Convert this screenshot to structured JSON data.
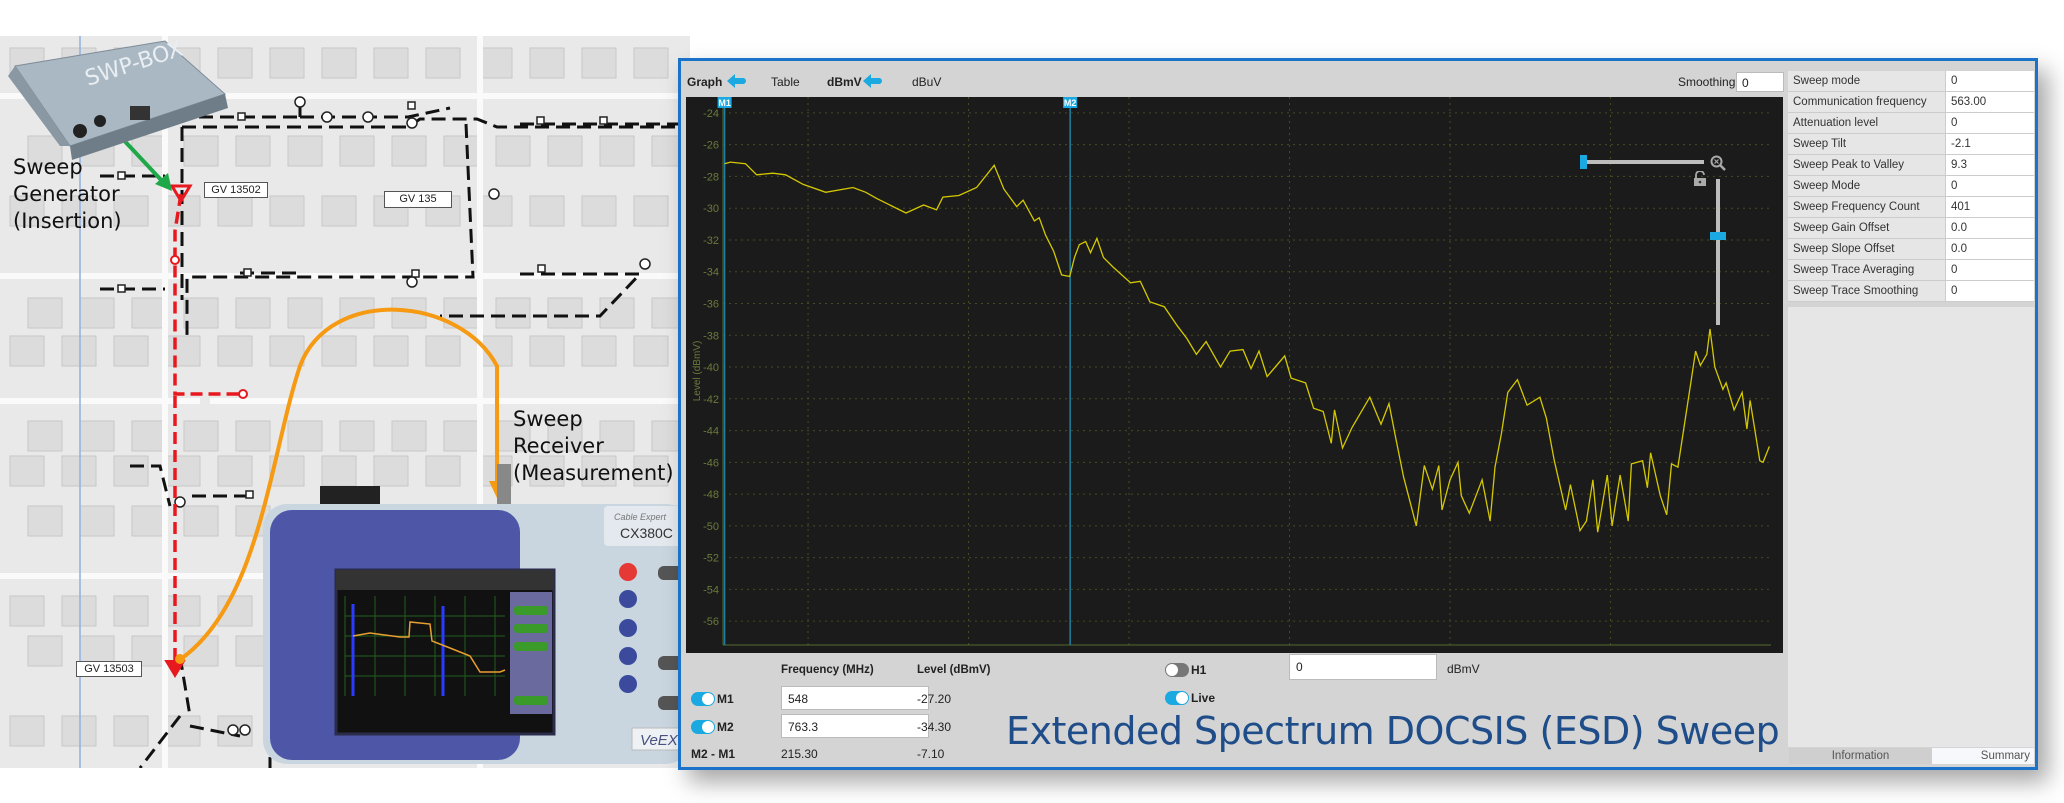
{
  "map": {
    "generator_label": [
      "Sweep",
      "Generator",
      "(Insertion)"
    ],
    "receiver_label": [
      "Sweep",
      "Receiver",
      "(Measurement)"
    ],
    "node_labels": [
      "GV 13502",
      "GV  135",
      "GV 13503"
    ],
    "swp_box_label": "SWP-BOX",
    "device": {
      "brand_label": "Cable Expert",
      "model": "CX380C",
      "logo": "VeEX"
    },
    "colors": {
      "insertion_path": "#e8191e",
      "measurement_cable": "#f59a12",
      "generator_link": "#1ea84a",
      "plant_cable": "#111111"
    }
  },
  "toolbar": {
    "graph": "Graph",
    "table": "Table",
    "dbmv": "dBmV",
    "dbuv": "dBuV",
    "smoothing_label": "Smoothing",
    "smoothing_value": "0",
    "selected_icon": "arrow-left-icon"
  },
  "graph": {
    "zoom_h_level": 0,
    "zoom_v_level": 0.61,
    "zoom_icon": "zoom-reset-icon",
    "lock_icon": "lock-open-icon"
  },
  "chart_data": {
    "type": "line",
    "xlabel": "Frequency (MHz)",
    "ylabel": "Level (dBmV)",
    "xlim": [
      547,
      1200
    ],
    "ylim": [
      -57.5,
      -23
    ],
    "xticks": [
      600,
      700,
      800,
      900,
      1000,
      1100
    ],
    "yticks": [
      -24,
      -26,
      -28,
      -30,
      -32,
      -34,
      -36,
      -38,
      -40,
      -42,
      -44,
      -46,
      -48,
      -50,
      -52,
      -54,
      -56
    ],
    "grid": true,
    "trace_color": "#d4c800",
    "markers": [
      {
        "name": "M1",
        "x": 548
      },
      {
        "name": "M2",
        "x": 763.3
      }
    ],
    "points": [
      [
        548,
        -27.2
      ],
      [
        551.6,
        -27.1
      ],
      [
        561,
        -27.2
      ],
      [
        568,
        -27.9
      ],
      [
        578,
        -27.8
      ],
      [
        586,
        -27.9
      ],
      [
        597,
        -28.5
      ],
      [
        611,
        -29.0
      ],
      [
        628,
        -28.7
      ],
      [
        636,
        -29.0
      ],
      [
        643,
        -29.4
      ],
      [
        661,
        -30.3
      ],
      [
        672,
        -29.8
      ],
      [
        680,
        -30.1
      ],
      [
        684,
        -29.3
      ],
      [
        694,
        -29.2
      ],
      [
        705,
        -28.7
      ],
      [
        716,
        -27.3
      ],
      [
        722,
        -28.8
      ],
      [
        730,
        -29.9
      ],
      [
        734,
        -29.5
      ],
      [
        741,
        -30.8
      ],
      [
        744,
        -30.6
      ],
      [
        748,
        -31.7
      ],
      [
        753,
        -32.7
      ],
      [
        758,
        -34.2
      ],
      [
        763,
        -34.3
      ],
      [
        766,
        -33.1
      ],
      [
        769,
        -32.3
      ],
      [
        773,
        -32.1
      ],
      [
        776,
        -32.8
      ],
      [
        780,
        -31.9
      ],
      [
        784,
        -33.1
      ],
      [
        790,
        -33.7
      ],
      [
        801,
        -34.7
      ],
      [
        807,
        -34.6
      ],
      [
        813,
        -35.9
      ],
      [
        822,
        -36.2
      ],
      [
        830,
        -37.4
      ],
      [
        836,
        -38.2
      ],
      [
        842,
        -39.2
      ],
      [
        848,
        -38.4
      ],
      [
        857,
        -40
      ],
      [
        863,
        -39
      ],
      [
        871,
        -38.9
      ],
      [
        876,
        -40.1
      ],
      [
        881,
        -39
      ],
      [
        886,
        -40.6
      ],
      [
        897,
        -39.3
      ],
      [
        901,
        -40.7
      ],
      [
        910,
        -41
      ],
      [
        915,
        -42.6
      ],
      [
        921,
        -42.8
      ],
      [
        926,
        -44.8
      ],
      [
        928,
        -42.7
      ],
      [
        933,
        -45.1
      ],
      [
        939,
        -43.8
      ],
      [
        950,
        -41.9
      ],
      [
        957,
        -43.6
      ],
      [
        962,
        -42.3
      ],
      [
        966,
        -44.4
      ],
      [
        971,
        -46.9
      ],
      [
        979,
        -50
      ],
      [
        984,
        -46.2
      ],
      [
        989,
        -47.7
      ],
      [
        993,
        -46.2
      ],
      [
        995,
        -49
      ],
      [
        1000,
        -47.1
      ],
      [
        1005,
        -46
      ],
      [
        1007,
        -48.1
      ],
      [
        1012,
        -49.2
      ],
      [
        1020,
        -47.1
      ],
      [
        1025,
        -49.7
      ],
      [
        1028,
        -46.3
      ],
      [
        1032,
        -44.2
      ],
      [
        1036,
        -41.6
      ],
      [
        1042,
        -40.8
      ],
      [
        1048,
        -42.4
      ],
      [
        1056,
        -41.9
      ],
      [
        1060,
        -43.2
      ],
      [
        1065,
        -45.9
      ],
      [
        1072,
        -49
      ],
      [
        1075,
        -47.4
      ],
      [
        1081,
        -50.3
      ],
      [
        1085,
        -49.7
      ],
      [
        1089,
        -47.1
      ],
      [
        1092,
        -50.4
      ],
      [
        1098,
        -46.8
      ],
      [
        1101,
        -50
      ],
      [
        1106,
        -46.8
      ],
      [
        1111,
        -49.7
      ],
      [
        1113,
        -46.1
      ],
      [
        1120,
        -45.9
      ],
      [
        1123,
        -47.6
      ],
      [
        1125,
        -45.4
      ],
      [
        1131,
        -48.1
      ],
      [
        1135,
        -49.3
      ],
      [
        1138,
        -46.1
      ],
      [
        1142,
        -46.3
      ],
      [
        1150,
        -41
      ],
      [
        1153,
        -39
      ],
      [
        1156,
        -39.9
      ],
      [
        1160,
        -39.2
      ],
      [
        1162,
        -37.6
      ],
      [
        1165,
        -40
      ],
      [
        1170,
        -41.4
      ],
      [
        1172,
        -41
      ],
      [
        1177,
        -42.7
      ],
      [
        1182,
        -41.6
      ],
      [
        1185,
        -43.9
      ],
      [
        1187,
        -42.1
      ],
      [
        1193,
        -45.9
      ],
      [
        1195,
        -46
      ],
      [
        1199,
        -45
      ]
    ]
  },
  "markers_panel": {
    "freq_header": "Frequency (MHz)",
    "level_header": "Level (dBmV)",
    "rows": [
      {
        "label": "M1",
        "enabled": true,
        "frequency": "548",
        "level": "-27.20"
      },
      {
        "label": "M2",
        "enabled": true,
        "frequency": "763.3",
        "level": "-34.30"
      }
    ],
    "delta": {
      "label": "M2 - M1",
      "frequency": "215.30",
      "level": "-7.10"
    },
    "h1": {
      "label": "H1",
      "enabled": false,
      "value": "0",
      "unit": "dBmV"
    },
    "live": {
      "label": "Live",
      "enabled": true
    }
  },
  "info_table": [
    {
      "key": "Sweep mode",
      "value": "0"
    },
    {
      "key": "Communication frequency",
      "value": "563.00"
    },
    {
      "key": "Attenuation level",
      "value": "0"
    },
    {
      "key": "Sweep Tilt",
      "value": "-2.1"
    },
    {
      "key": "Sweep Peak to Valley",
      "value": "9.3"
    },
    {
      "key": "Sweep Mode",
      "value": "0"
    },
    {
      "key": "Sweep Frequency Count",
      "value": "401"
    },
    {
      "key": "Sweep Gain Offset",
      "value": "0.0"
    },
    {
      "key": "Sweep Slope Offset",
      "value": "0.0"
    },
    {
      "key": "Sweep Trace Averaging",
      "value": "0"
    },
    {
      "key": "Sweep Trace Smoothing",
      "value": "0"
    }
  ],
  "tabs": [
    {
      "label": "Information",
      "active": false
    },
    {
      "label": "Summary",
      "active": true
    }
  ],
  "caption": "Extended Spectrum DOCSIS (ESD) Sweep"
}
